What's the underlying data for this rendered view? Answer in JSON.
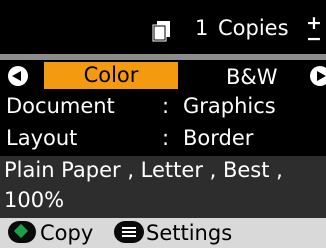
{
  "header": {
    "copies_count": "1",
    "copies_label": "Copies",
    "stepper_up": "+",
    "stepper_down": "−"
  },
  "tabs": [
    {
      "label": "Color",
      "selected": true
    },
    {
      "label": "B&W",
      "selected": false
    }
  ],
  "settings": {
    "document_label": "Document",
    "document_value": "Graphics",
    "layout_label": "Layout",
    "layout_value": "Border",
    "separator": ":"
  },
  "paper": {
    "line1": "Plain Paper , Letter , Best ,",
    "line2": "100%"
  },
  "footer": {
    "copy_label": "Copy",
    "settings_label": "Settings"
  },
  "colors": {
    "selected_tab": "#f39a10",
    "start_button": "#18a04a",
    "background": "#000000",
    "footer": "#d9d9d9"
  },
  "icons": [
    "copies-icon",
    "left-arrow-icon",
    "right-arrow-icon",
    "start-icon",
    "menu-icon"
  ]
}
